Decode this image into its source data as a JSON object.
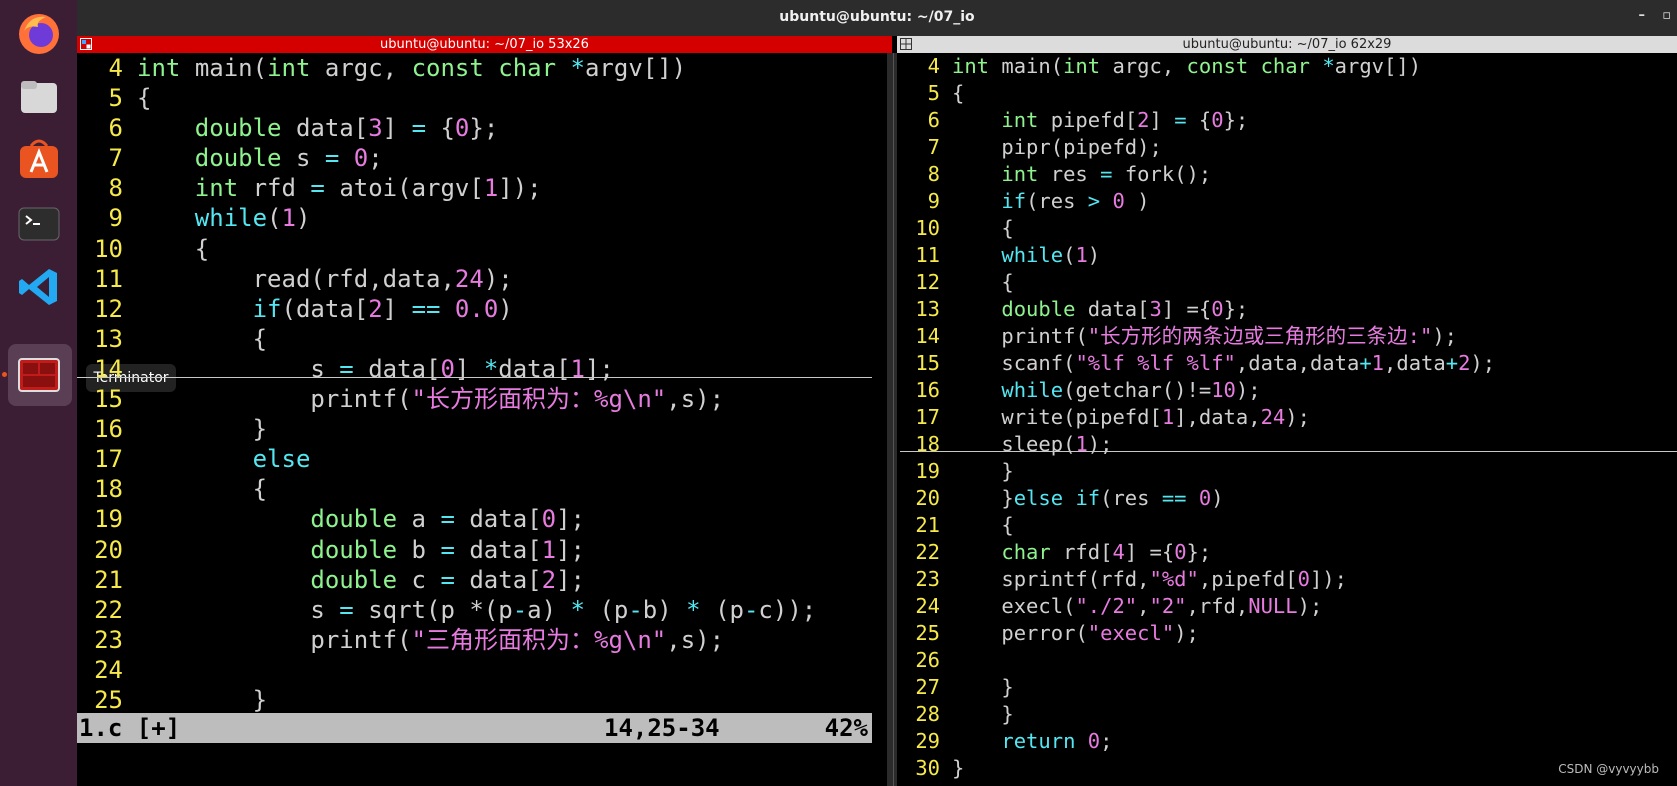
{
  "window": {
    "title": "ubuntu@ubuntu: ~/07_io"
  },
  "dock": {
    "items": [
      {
        "name": "firefox-icon"
      },
      {
        "name": "files-icon"
      },
      {
        "name": "app-center-icon"
      },
      {
        "name": "terminal-icon"
      },
      {
        "name": "vscode-icon"
      },
      {
        "name": "terminator-icon"
      }
    ],
    "tooltip": "Terminator"
  },
  "left_pane": {
    "title": "ubuntu@ubuntu: ~/07_io 53x26",
    "lines": [
      {
        "n": "4",
        "t": "int main(int argc, const char *argv[])"
      },
      {
        "n": "5",
        "t": "{"
      },
      {
        "n": "6",
        "t": "    double data[3] = {0};"
      },
      {
        "n": "7",
        "t": "    double s = 0;"
      },
      {
        "n": "8",
        "t": "    int rfd = atoi(argv[1]);"
      },
      {
        "n": "9",
        "t": "    while(1)"
      },
      {
        "n": "10",
        "t": "    {"
      },
      {
        "n": "11",
        "t": "        read(rfd,data,24);"
      },
      {
        "n": "12",
        "t": "        if(data[2] == 0.0)"
      },
      {
        "n": "13",
        "t": "        {"
      },
      {
        "n": "14",
        "t": "            s = data[0] *data[1];"
      },
      {
        "n": "15",
        "t": "            printf(\"长方形面积为：%g\\n\",s);"
      },
      {
        "n": "16",
        "t": "        }"
      },
      {
        "n": "17",
        "t": "        else"
      },
      {
        "n": "18",
        "t": "        {"
      },
      {
        "n": "19",
        "t": "            double a = data[0];"
      },
      {
        "n": "20",
        "t": "            double b = data[1];"
      },
      {
        "n": "21",
        "t": "            double c = data[2];"
      },
      {
        "n": "22",
        "t": "            s = sqrt(p *(p-a) * (p-b) * (p-c));"
      },
      {
        "n": "23",
        "t": "            printf(\"三角形面积为：%g\\n\",s);"
      },
      {
        "n": "24",
        "t": ""
      },
      {
        "n": "25",
        "t": "        }"
      }
    ],
    "status": {
      "file": "1.c [+]",
      "position": "14,25-34",
      "percent": "42%"
    }
  },
  "right_pane": {
    "title": "ubuntu@ubuntu: ~/07_io 62x29",
    "lines": [
      {
        "n": "4",
        "t": "int main(int argc, const char *argv[])"
      },
      {
        "n": "5",
        "t": "{"
      },
      {
        "n": "6",
        "t": "    int pipefd[2] = {0};"
      },
      {
        "n": "7",
        "t": "    pipr(pipefd);"
      },
      {
        "n": "8",
        "t": "    int res = fork();"
      },
      {
        "n": "9",
        "t": "    if(res > 0 )"
      },
      {
        "n": "10",
        "t": "    {"
      },
      {
        "n": "11",
        "t": "    while(1)"
      },
      {
        "n": "12",
        "t": "    {"
      },
      {
        "n": "13",
        "t": "    double data[3] ={0};"
      },
      {
        "n": "14",
        "t": "    printf(\"长方形的两条边或三角形的三条边:\");"
      },
      {
        "n": "15",
        "t": "    scanf(\"%lf %lf %lf\",data,data+1,data+2);"
      },
      {
        "n": "16",
        "t": "    while(getchar()!=10);"
      },
      {
        "n": "17",
        "t": "    write(pipefd[1],data,24);"
      },
      {
        "n": "18",
        "t": "    sleep(1);"
      },
      {
        "n": "19",
        "t": "    }"
      },
      {
        "n": "20",
        "t": "    }else if(res == 0)"
      },
      {
        "n": "21",
        "t": "    {"
      },
      {
        "n": "22",
        "t": "    char rfd[4] ={0};"
      },
      {
        "n": "23",
        "t": "    sprintf(rfd,\"%d\",pipefd[0]);"
      },
      {
        "n": "24",
        "t": "    execl(\"./2\",\"2\",rfd,NULL);"
      },
      {
        "n": "25",
        "t": "    perror(\"execl\");"
      },
      {
        "n": "26",
        "t": ""
      },
      {
        "n": "27",
        "t": "    }"
      },
      {
        "n": "28",
        "t": "    }"
      },
      {
        "n": "29",
        "t": "    return 0;"
      },
      {
        "n": "30",
        "t": "}"
      }
    ]
  },
  "watermark": "CSDN @vyvyybb",
  "colors": {
    "line_number": "#f6e94a",
    "keyword": "#54e7f2",
    "type": "#8ef38e",
    "string_number": "#e77be0",
    "active_title_bar": "#d40000",
    "inactive_title_bar": "#dcdcdc",
    "status_bar": "#bdbdbd",
    "dock": "#3c1e34"
  }
}
